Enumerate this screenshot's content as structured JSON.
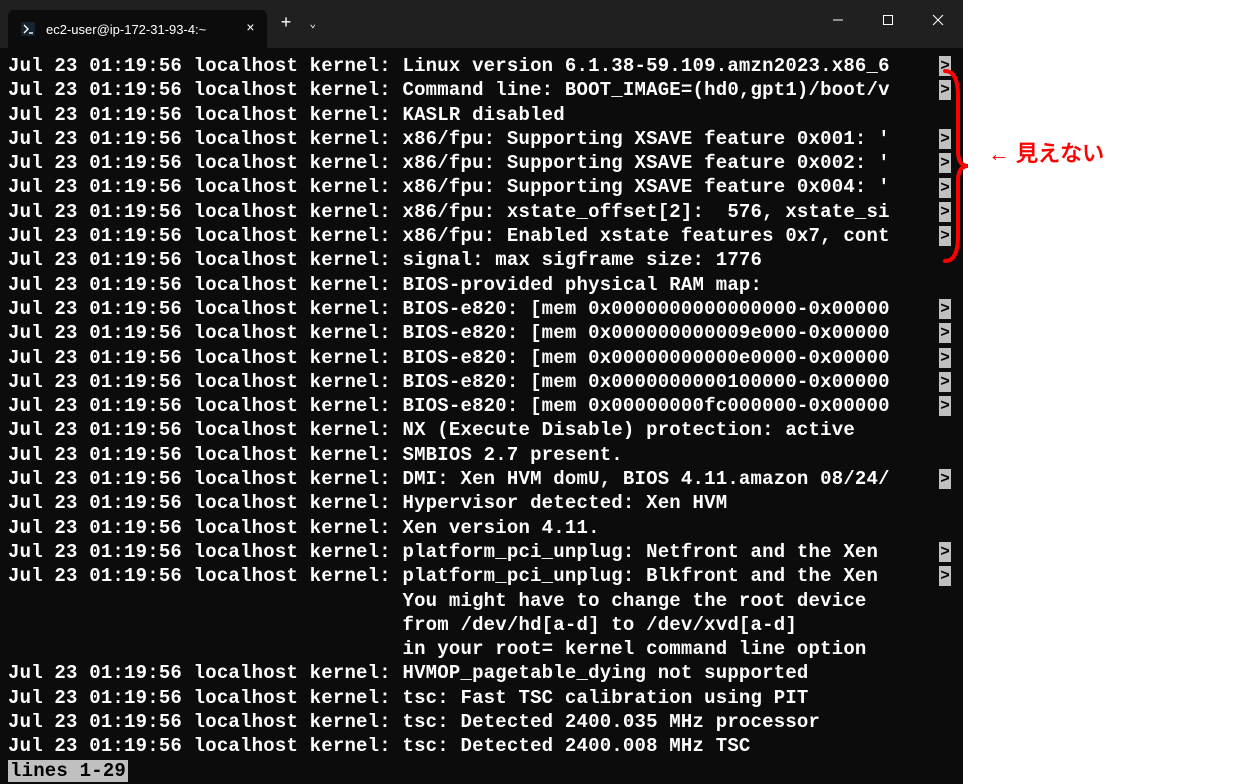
{
  "titlebar": {
    "tab_title": "ec2-user@ip-172-31-93-4:~",
    "close_glyph": "×",
    "newtab_glyph": "+",
    "dropdown_glyph": "⌄"
  },
  "annotation": {
    "text": "← 見えない"
  },
  "terminal": {
    "lines": [
      {
        "text": "Jul 23 01:19:56 localhost kernel: Linux version 6.1.38-59.109.amzn2023.x86_6",
        "trunc": true
      },
      {
        "text": "Jul 23 01:19:56 localhost kernel: Command line: BOOT_IMAGE=(hd0,gpt1)/boot/v",
        "trunc": true
      },
      {
        "text": "Jul 23 01:19:56 localhost kernel: KASLR disabled",
        "trunc": false
      },
      {
        "text": "Jul 23 01:19:56 localhost kernel: x86/fpu: Supporting XSAVE feature 0x001: '",
        "trunc": true
      },
      {
        "text": "Jul 23 01:19:56 localhost kernel: x86/fpu: Supporting XSAVE feature 0x002: '",
        "trunc": true
      },
      {
        "text": "Jul 23 01:19:56 localhost kernel: x86/fpu: Supporting XSAVE feature 0x004: '",
        "trunc": true
      },
      {
        "text": "Jul 23 01:19:56 localhost kernel: x86/fpu: xstate_offset[2]:  576, xstate_si",
        "trunc": true
      },
      {
        "text": "Jul 23 01:19:56 localhost kernel: x86/fpu: Enabled xstate features 0x7, cont",
        "trunc": true
      },
      {
        "text": "Jul 23 01:19:56 localhost kernel: signal: max sigframe size: 1776",
        "trunc": false
      },
      {
        "text": "Jul 23 01:19:56 localhost kernel: BIOS-provided physical RAM map:",
        "trunc": false
      },
      {
        "text": "Jul 23 01:19:56 localhost kernel: BIOS-e820: [mem 0x0000000000000000-0x00000",
        "trunc": true
      },
      {
        "text": "Jul 23 01:19:56 localhost kernel: BIOS-e820: [mem 0x000000000009e000-0x00000",
        "trunc": true
      },
      {
        "text": "Jul 23 01:19:56 localhost kernel: BIOS-e820: [mem 0x00000000000e0000-0x00000",
        "trunc": true
      },
      {
        "text": "Jul 23 01:19:56 localhost kernel: BIOS-e820: [mem 0x0000000000100000-0x00000",
        "trunc": true
      },
      {
        "text": "Jul 23 01:19:56 localhost kernel: BIOS-e820: [mem 0x00000000fc000000-0x00000",
        "trunc": true
      },
      {
        "text": "Jul 23 01:19:56 localhost kernel: NX (Execute Disable) protection: active",
        "trunc": false
      },
      {
        "text": "Jul 23 01:19:56 localhost kernel: SMBIOS 2.7 present.",
        "trunc": false
      },
      {
        "text": "Jul 23 01:19:56 localhost kernel: DMI: Xen HVM domU, BIOS 4.11.amazon 08/24/",
        "trunc": true
      },
      {
        "text": "Jul 23 01:19:56 localhost kernel: Hypervisor detected: Xen HVM",
        "trunc": false
      },
      {
        "text": "Jul 23 01:19:56 localhost kernel: Xen version 4.11.",
        "trunc": false
      },
      {
        "text": "Jul 23 01:19:56 localhost kernel: platform_pci_unplug: Netfront and the Xen ",
        "trunc": true
      },
      {
        "text": "Jul 23 01:19:56 localhost kernel: platform_pci_unplug: Blkfront and the Xen ",
        "trunc": true
      },
      {
        "text": "                                  You might have to change the root device",
        "trunc": false
      },
      {
        "text": "                                  from /dev/hd[a-d] to /dev/xvd[a-d]",
        "trunc": false
      },
      {
        "text": "                                  in your root= kernel command line option",
        "trunc": false
      },
      {
        "text": "Jul 23 01:19:56 localhost kernel: HVMOP_pagetable_dying not supported",
        "trunc": false
      },
      {
        "text": "Jul 23 01:19:56 localhost kernel: tsc: Fast TSC calibration using PIT",
        "trunc": false
      },
      {
        "text": "Jul 23 01:19:56 localhost kernel: tsc: Detected 2400.035 MHz processor",
        "trunc": false
      },
      {
        "text": "Jul 23 01:19:56 localhost kernel: tsc: Detected 2400.008 MHz TSC",
        "trunc": false
      }
    ],
    "status": "lines 1-29"
  }
}
